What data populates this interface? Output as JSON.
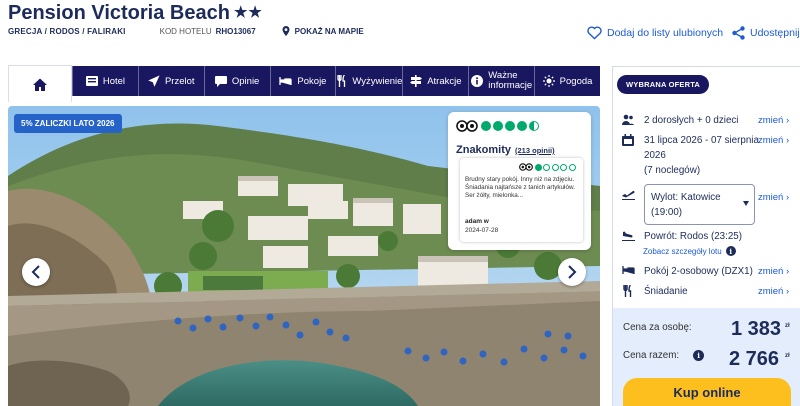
{
  "hotel": {
    "name": "Pension Victoria Beach",
    "stars": "★★",
    "breadcrumb": "GRECJA / RODOS / FALIRAKI",
    "code_label": "KOD HOTELU",
    "code": "RHO13067",
    "map_link": "POKAŻ NA MAPIE"
  },
  "actions": {
    "favorites": "Dodaj do listy ulubionych",
    "share": "Udostępnij"
  },
  "nav": {
    "tabs": [
      {
        "label": "Hotel",
        "icon": "hotel-icon"
      },
      {
        "label": "Przelot",
        "icon": "plane-icon"
      },
      {
        "label": "Opinie",
        "icon": "speech-bubble-icon"
      },
      {
        "label": "Pokoje",
        "icon": "bed-icon"
      },
      {
        "label": "Wyżywienie",
        "icon": "cutlery-icon"
      },
      {
        "label": "Atrakcje",
        "icon": "signpost-icon"
      },
      {
        "label": "Ważne informacje",
        "line1": "Ważne",
        "line2": "informacje",
        "icon": "info-icon"
      },
      {
        "label": "Pogoda",
        "icon": "sun-icon"
      }
    ]
  },
  "gallery": {
    "promo_badge": "5% ZALICZKI LATO 2026"
  },
  "review": {
    "overall_bubbles": 4.5,
    "overall_label": "Znakomity",
    "count_link": "(213 opinii)",
    "single_bubbles": 1,
    "text": "Brudny stary pokój. Inny niż na zdjęciu. Śniadania najtańsze z tanich artykułów. Ser żółty, mielonka...",
    "author": "adam w",
    "date": "2024-07-28"
  },
  "offer": {
    "tag": "WYBRANA OFERTA",
    "change_label": "zmień",
    "travelers": "2 dorosłych + 0 dzieci",
    "dates_line1": "31 lipca 2026 - 07 sierpnia",
    "dates_line2": "2026",
    "nights": "(7 noclegów)",
    "departure_line1": "Wylot: Katowice",
    "departure_line2": "(19:00)",
    "return": "Powrót: Rodos (23:25)",
    "flight_details": "Zobacz szczegóły lotu",
    "room": "Pokój 2-osobowy (DZX1)",
    "board": "Śniadanie",
    "price_per_person_label": "Cena za osobę:",
    "price_per_person": "1 383",
    "price_total_label": "Cena razem:",
    "price_total": "2 766",
    "currency": "zł",
    "buy_button": "Kup online"
  },
  "colors": {
    "navy": "#1a1761",
    "link_blue": "#1c5ad6",
    "tripadvisor_green": "#00aa6c",
    "cta_yellow": "#fcbf1e",
    "price_bg": "#e4edfb",
    "promo_blue": "#2563c9"
  }
}
